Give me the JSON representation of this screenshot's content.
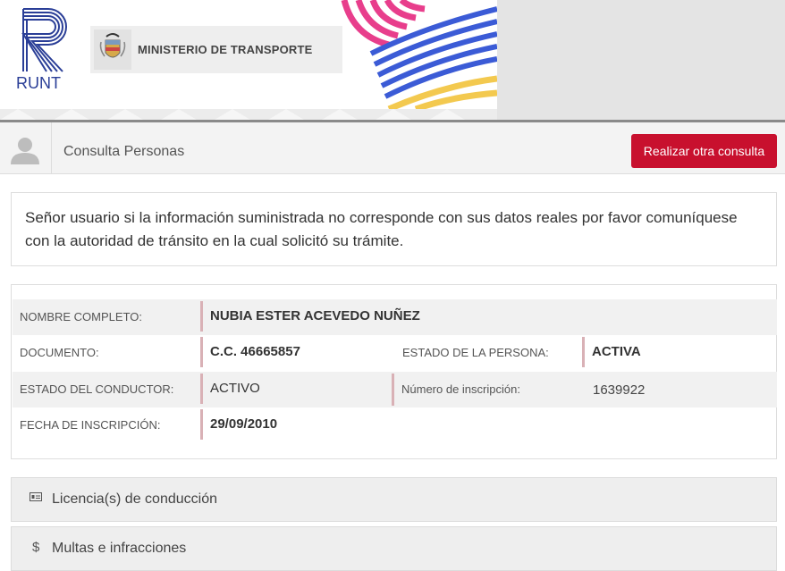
{
  "header": {
    "runt_label": "RUNT",
    "ministerio_label": "MINISTERIO DE TRANSPORTE"
  },
  "titlebar": {
    "title": "Consulta Personas",
    "button_label": "Realizar otra consulta"
  },
  "notice": {
    "text": "Señor usuario si la información suministrada no corresponde con sus datos reales por favor comuníquese con la autoridad de tránsito en la cual solicitó su trámite."
  },
  "person": {
    "nombre_label": "NOMBRE COMPLETO:",
    "nombre_value": "NUBIA ESTER ACEVEDO NUÑEZ",
    "documento_label": "DOCUMENTO:",
    "documento_value": "C.C. 46665857",
    "estado_persona_label": "ESTADO DE LA PERSONA:",
    "estado_persona_value": "ACTIVA",
    "estado_conductor_label": "ESTADO DEL CONDUCTOR:",
    "estado_conductor_value": "ACTIVO",
    "inscripcion_num_label": "Número de inscripción:",
    "inscripcion_num_value": "1639922",
    "fecha_label": "FECHA DE INSCRIPCIÓN:",
    "fecha_value": "29/09/2010"
  },
  "accordions": [
    {
      "icon": "id-card-icon",
      "label": "Licencia(s) de conducción"
    },
    {
      "icon": "dollar-icon",
      "label": "Multas e infracciones"
    }
  ],
  "colors": {
    "accent_red": "#c8102e",
    "runt_blue": "#2a3e97"
  }
}
